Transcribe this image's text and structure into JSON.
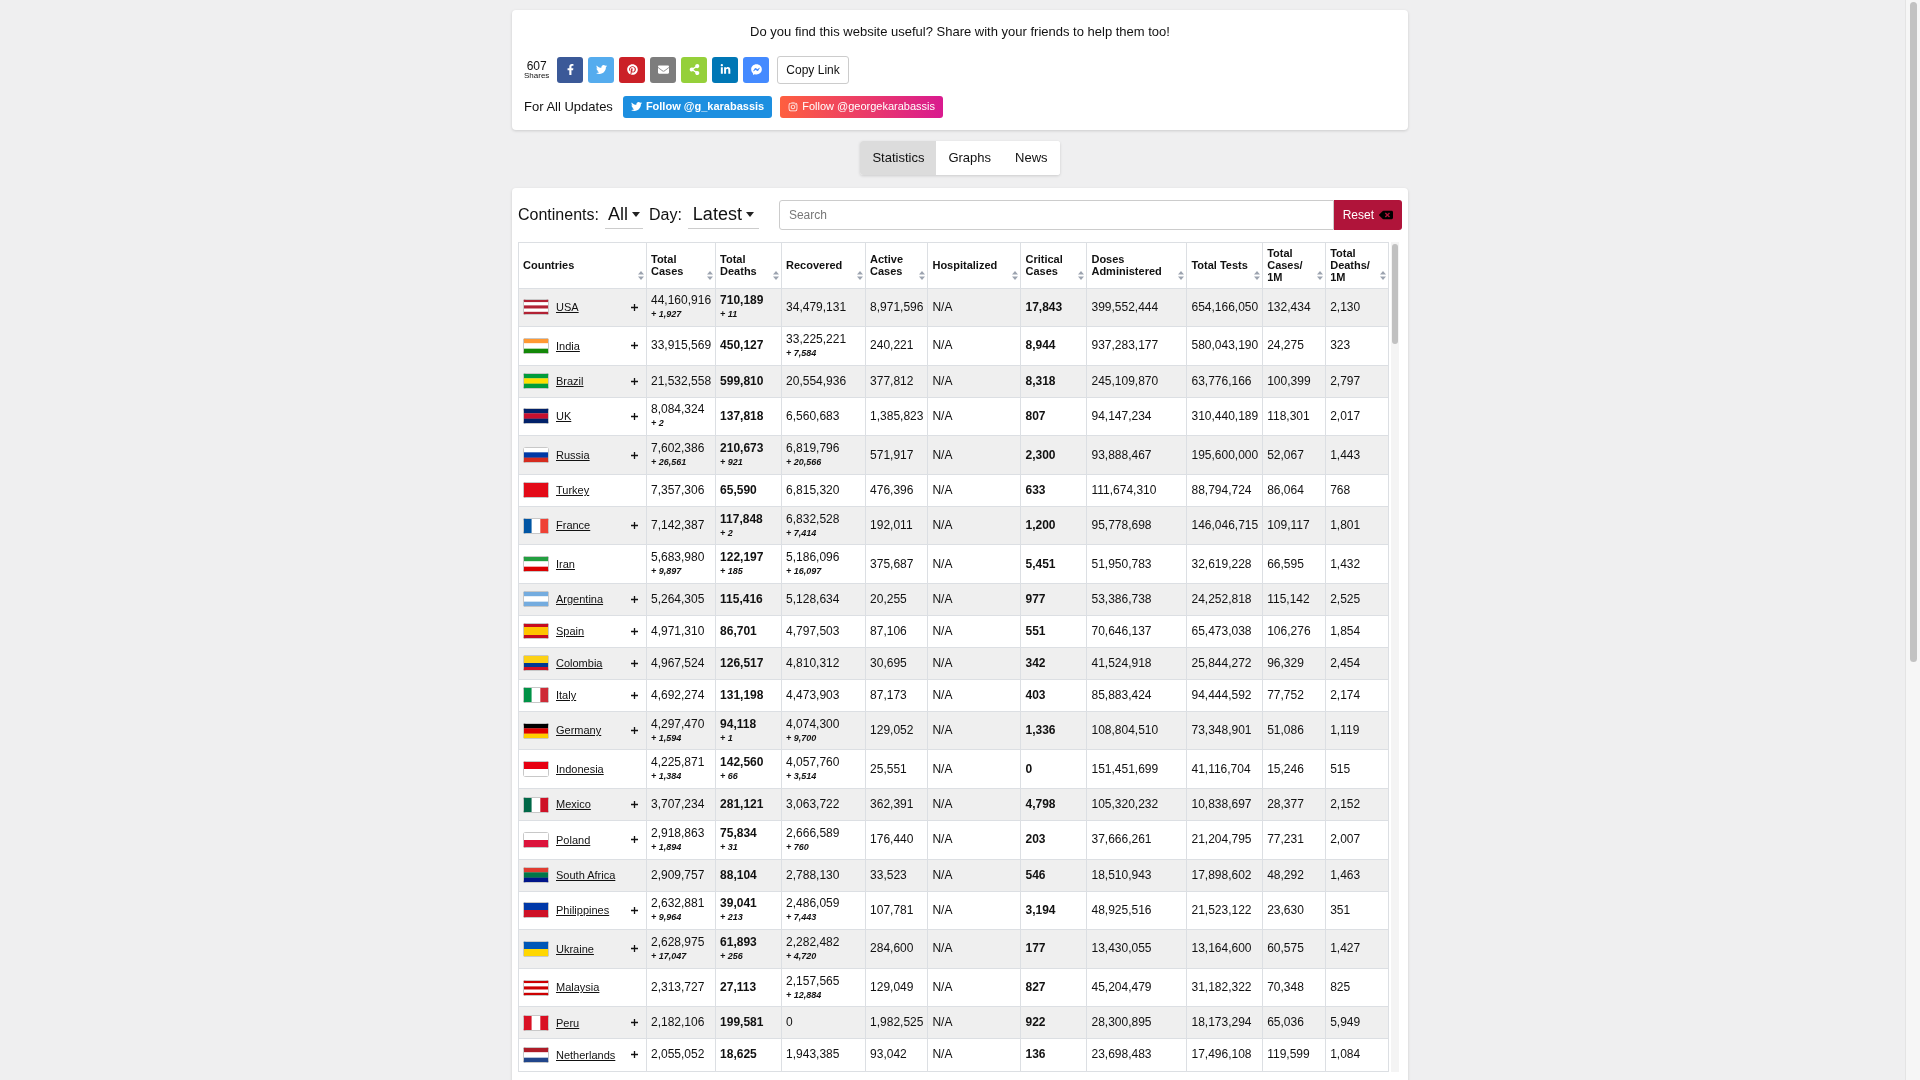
{
  "share": {
    "prompt": "Do you find this website useful? Share with your friends to help them too!",
    "count": "607",
    "count_label": "Shares",
    "buttons": [
      {
        "kind": "facebook",
        "color": "#3b5998"
      },
      {
        "kind": "twitter",
        "color": "#55acee"
      },
      {
        "kind": "pinterest",
        "color": "#cb2027"
      },
      {
        "kind": "email",
        "color": "#7d7d7d"
      },
      {
        "kind": "share",
        "color": "#95d03a"
      },
      {
        "kind": "linkedin",
        "color": "#0077b5"
      },
      {
        "kind": "messenger",
        "color": "#448aff"
      }
    ],
    "copy_link": "Copy Link",
    "updates_label": "For All Updates",
    "follow": [
      {
        "kind": "twitter",
        "label": "Follow @g_karabassis"
      },
      {
        "kind": "instagram",
        "label": "Follow @georgekarabassis"
      }
    ]
  },
  "tabs": [
    {
      "label": "Statistics",
      "selected": true
    },
    {
      "label": "Graphs",
      "selected": false
    },
    {
      "label": "News",
      "selected": false
    }
  ],
  "filters": {
    "continents_label": "Continents:",
    "continents_value": "All",
    "day_label": "Day:",
    "day_value": "Latest",
    "search_placeholder": "Search",
    "reset": "Reset"
  },
  "table": {
    "columns": [
      {
        "label": "Countries"
      },
      {
        "label": "Total Cases"
      },
      {
        "label": "Total Deaths",
        "bold": true
      },
      {
        "label": "Recovered"
      },
      {
        "label": "Active Cases"
      },
      {
        "label": "Hospitalized"
      },
      {
        "label": "Critical Cases",
        "bold": true
      },
      {
        "label": "Doses Administered"
      },
      {
        "label": "Total Tests"
      },
      {
        "label": "Total Cases/ 1M"
      },
      {
        "label": "Total Deaths/ 1M"
      }
    ],
    "rows": [
      {
        "expandable": true,
        "cells": [
          {
            "text": "USA"
          },
          {
            "text": "44,160,916",
            "new": "+ 1,927"
          },
          {
            "text": "710,189",
            "new": "+ 11"
          },
          {
            "text": "34,479,131"
          },
          {
            "text": "8,971,596"
          },
          {
            "text": "N/A"
          },
          {
            "text": "17,843"
          },
          {
            "text": "399,552,444"
          },
          {
            "text": "654,166,050"
          },
          {
            "text": "132,434"
          },
          {
            "text": "2,130"
          }
        ]
      },
      {
        "expandable": true,
        "cells": [
          {
            "text": "India"
          },
          {
            "text": "33,915,569"
          },
          {
            "text": "450,127"
          },
          {
            "text": "33,225,221",
            "new": "+ 7,584"
          },
          {
            "text": "240,221"
          },
          {
            "text": "N/A"
          },
          {
            "text": "8,944"
          },
          {
            "text": "937,283,177"
          },
          {
            "text": "580,043,190"
          },
          {
            "text": "24,275"
          },
          {
            "text": "323"
          }
        ]
      },
      {
        "expandable": true,
        "cells": [
          {
            "text": "Brazil"
          },
          {
            "text": "21,532,558"
          },
          {
            "text": "599,810"
          },
          {
            "text": "20,554,936"
          },
          {
            "text": "377,812"
          },
          {
            "text": "N/A"
          },
          {
            "text": "8,318"
          },
          {
            "text": "245,109,870"
          },
          {
            "text": "63,776,166"
          },
          {
            "text": "100,399"
          },
          {
            "text": "2,797"
          }
        ]
      },
      {
        "expandable": true,
        "cells": [
          {
            "text": "UK"
          },
          {
            "text": "8,084,324",
            "new": "+ 2"
          },
          {
            "text": "137,818"
          },
          {
            "text": "6,560,683"
          },
          {
            "text": "1,385,823"
          },
          {
            "text": "N/A"
          },
          {
            "text": "807"
          },
          {
            "text": "94,147,234"
          },
          {
            "text": "310,440,189"
          },
          {
            "text": "118,301"
          },
          {
            "text": "2,017"
          }
        ]
      },
      {
        "expandable": true,
        "cells": [
          {
            "text": "Russia"
          },
          {
            "text": "7,602,386",
            "new": "+ 26,561"
          },
          {
            "text": "210,673",
            "new": "+ 921"
          },
          {
            "text": "6,819,796",
            "new": "+ 20,566"
          },
          {
            "text": "571,917"
          },
          {
            "text": "N/A"
          },
          {
            "text": "2,300"
          },
          {
            "text": "93,888,467"
          },
          {
            "text": "195,600,000"
          },
          {
            "text": "52,067"
          },
          {
            "text": "1,443"
          }
        ]
      },
      {
        "expandable": false,
        "cells": [
          {
            "text": "Turkey"
          },
          {
            "text": "7,357,306"
          },
          {
            "text": "65,590"
          },
          {
            "text": "6,815,320"
          },
          {
            "text": "476,396"
          },
          {
            "text": "N/A"
          },
          {
            "text": "633"
          },
          {
            "text": "111,674,310"
          },
          {
            "text": "88,794,724"
          },
          {
            "text": "86,064"
          },
          {
            "text": "768"
          }
        ]
      },
      {
        "expandable": true,
        "cells": [
          {
            "text": "France"
          },
          {
            "text": "7,142,387"
          },
          {
            "text": "117,848",
            "new": "+ 2"
          },
          {
            "text": "6,832,528",
            "new": "+ 7,414"
          },
          {
            "text": "192,011"
          },
          {
            "text": "N/A"
          },
          {
            "text": "1,200"
          },
          {
            "text": "95,778,698"
          },
          {
            "text": "146,046,715"
          },
          {
            "text": "109,117"
          },
          {
            "text": "1,801"
          }
        ]
      },
      {
        "expandable": false,
        "cells": [
          {
            "text": "Iran"
          },
          {
            "text": "5,683,980",
            "new": "+ 9,897"
          },
          {
            "text": "122,197",
            "new": "+ 185"
          },
          {
            "text": "5,186,096",
            "new": "+ 16,097"
          },
          {
            "text": "375,687"
          },
          {
            "text": "N/A"
          },
          {
            "text": "5,451"
          },
          {
            "text": "51,950,783"
          },
          {
            "text": "32,619,228"
          },
          {
            "text": "66,595"
          },
          {
            "text": "1,432"
          }
        ]
      },
      {
        "expandable": true,
        "cells": [
          {
            "text": "Argentina"
          },
          {
            "text": "5,264,305"
          },
          {
            "text": "115,416"
          },
          {
            "text": "5,128,634"
          },
          {
            "text": "20,255"
          },
          {
            "text": "N/A"
          },
          {
            "text": "977"
          },
          {
            "text": "53,386,738"
          },
          {
            "text": "24,252,818"
          },
          {
            "text": "115,142"
          },
          {
            "text": "2,525"
          }
        ]
      },
      {
        "expandable": true,
        "cells": [
          {
            "text": "Spain"
          },
          {
            "text": "4,971,310"
          },
          {
            "text": "86,701"
          },
          {
            "text": "4,797,503"
          },
          {
            "text": "87,106"
          },
          {
            "text": "N/A"
          },
          {
            "text": "551"
          },
          {
            "text": "70,646,137"
          },
          {
            "text": "65,473,038"
          },
          {
            "text": "106,276"
          },
          {
            "text": "1,854"
          }
        ]
      },
      {
        "expandable": true,
        "cells": [
          {
            "text": "Colombia"
          },
          {
            "text": "4,967,524"
          },
          {
            "text": "126,517"
          },
          {
            "text": "4,810,312"
          },
          {
            "text": "30,695"
          },
          {
            "text": "N/A"
          },
          {
            "text": "342"
          },
          {
            "text": "41,524,918"
          },
          {
            "text": "25,844,272"
          },
          {
            "text": "96,329"
          },
          {
            "text": "2,454"
          }
        ]
      },
      {
        "expandable": true,
        "cells": [
          {
            "text": "Italy"
          },
          {
            "text": "4,692,274"
          },
          {
            "text": "131,198"
          },
          {
            "text": "4,473,903"
          },
          {
            "text": "87,173"
          },
          {
            "text": "N/A"
          },
          {
            "text": "403"
          },
          {
            "text": "85,883,424"
          },
          {
            "text": "94,444,592"
          },
          {
            "text": "77,752"
          },
          {
            "text": "2,174"
          }
        ]
      },
      {
        "expandable": true,
        "cells": [
          {
            "text": "Germany"
          },
          {
            "text": "4,297,470",
            "new": "+ 1,594"
          },
          {
            "text": "94,118",
            "new": "+ 1"
          },
          {
            "text": "4,074,300",
            "new": "+ 9,700"
          },
          {
            "text": "129,052"
          },
          {
            "text": "N/A"
          },
          {
            "text": "1,336"
          },
          {
            "text": "108,804,510"
          },
          {
            "text": "73,348,901"
          },
          {
            "text": "51,086"
          },
          {
            "text": "1,119"
          }
        ]
      },
      {
        "expandable": false,
        "cells": [
          {
            "text": "Indonesia"
          },
          {
            "text": "4,225,871",
            "new": "+ 1,384"
          },
          {
            "text": "142,560",
            "new": "+ 66"
          },
          {
            "text": "4,057,760",
            "new": "+ 3,514"
          },
          {
            "text": "25,551"
          },
          {
            "text": "N/A"
          },
          {
            "text": "0"
          },
          {
            "text": "151,451,699"
          },
          {
            "text": "41,116,704"
          },
          {
            "text": "15,246"
          },
          {
            "text": "515"
          }
        ]
      },
      {
        "expandable": true,
        "cells": [
          {
            "text": "Mexico"
          },
          {
            "text": "3,707,234"
          },
          {
            "text": "281,121"
          },
          {
            "text": "3,063,722"
          },
          {
            "text": "362,391"
          },
          {
            "text": "N/A"
          },
          {
            "text": "4,798"
          },
          {
            "text": "105,320,232"
          },
          {
            "text": "10,838,697"
          },
          {
            "text": "28,377"
          },
          {
            "text": "2,152"
          }
        ]
      },
      {
        "expandable": true,
        "cells": [
          {
            "text": "Poland"
          },
          {
            "text": "2,918,863",
            "new": "+ 1,894"
          },
          {
            "text": "75,834",
            "new": "+ 31"
          },
          {
            "text": "2,666,589",
            "new": "+ 760"
          },
          {
            "text": "176,440"
          },
          {
            "text": "N/A"
          },
          {
            "text": "203"
          },
          {
            "text": "37,666,261"
          },
          {
            "text": "21,204,795"
          },
          {
            "text": "77,231"
          },
          {
            "text": "2,007"
          }
        ]
      },
      {
        "expandable": false,
        "cells": [
          {
            "text": "South Africa"
          },
          {
            "text": "2,909,757"
          },
          {
            "text": "88,104"
          },
          {
            "text": "2,788,130"
          },
          {
            "text": "33,523"
          },
          {
            "text": "N/A"
          },
          {
            "text": "546"
          },
          {
            "text": "18,510,943"
          },
          {
            "text": "17,898,602"
          },
          {
            "text": "48,292"
          },
          {
            "text": "1,463"
          }
        ]
      },
      {
        "expandable": true,
        "cells": [
          {
            "text": "Philippines"
          },
          {
            "text": "2,632,881",
            "new": "+ 9,964"
          },
          {
            "text": "39,041",
            "new": "+ 213"
          },
          {
            "text": "2,486,059",
            "new": "+ 7,443"
          },
          {
            "text": "107,781"
          },
          {
            "text": "N/A"
          },
          {
            "text": "3,194"
          },
          {
            "text": "48,925,516"
          },
          {
            "text": "21,523,122"
          },
          {
            "text": "23,630"
          },
          {
            "text": "351"
          }
        ]
      },
      {
        "expandable": true,
        "cells": [
          {
            "text": "Ukraine"
          },
          {
            "text": "2,628,975",
            "new": "+ 17,047"
          },
          {
            "text": "61,893",
            "new": "+ 256"
          },
          {
            "text": "2,282,482",
            "new": "+ 4,720"
          },
          {
            "text": "284,600"
          },
          {
            "text": "N/A"
          },
          {
            "text": "177"
          },
          {
            "text": "13,430,055"
          },
          {
            "text": "13,164,600"
          },
          {
            "text": "60,575"
          },
          {
            "text": "1,427"
          }
        ]
      },
      {
        "expandable": false,
        "cells": [
          {
            "text": "Malaysia"
          },
          {
            "text": "2,313,727"
          },
          {
            "text": "27,113"
          },
          {
            "text": "2,157,565",
            "new": "+ 12,884"
          },
          {
            "text": "129,049"
          },
          {
            "text": "N/A"
          },
          {
            "text": "827"
          },
          {
            "text": "45,204,479"
          },
          {
            "text": "31,182,322"
          },
          {
            "text": "70,348"
          },
          {
            "text": "825"
          }
        ]
      },
      {
        "expandable": true,
        "cells": [
          {
            "text": "Peru"
          },
          {
            "text": "2,182,106"
          },
          {
            "text": "199,581"
          },
          {
            "text": "0"
          },
          {
            "text": "1,982,525"
          },
          {
            "text": "N/A"
          },
          {
            "text": "922"
          },
          {
            "text": "28,300,895"
          },
          {
            "text": "18,173,294"
          },
          {
            "text": "65,036"
          },
          {
            "text": "5,949"
          }
        ]
      },
      {
        "expandable": true,
        "cells": [
          {
            "text": "Netherlands"
          },
          {
            "text": "2,055,052"
          },
          {
            "text": "18,625"
          },
          {
            "text": "1,943,385"
          },
          {
            "text": "93,042"
          },
          {
            "text": "N/A"
          },
          {
            "text": "136"
          },
          {
            "text": "23,698,483"
          },
          {
            "text": "17,496,108"
          },
          {
            "text": "119,599"
          },
          {
            "text": "1,084"
          }
        ]
      }
    ]
  }
}
